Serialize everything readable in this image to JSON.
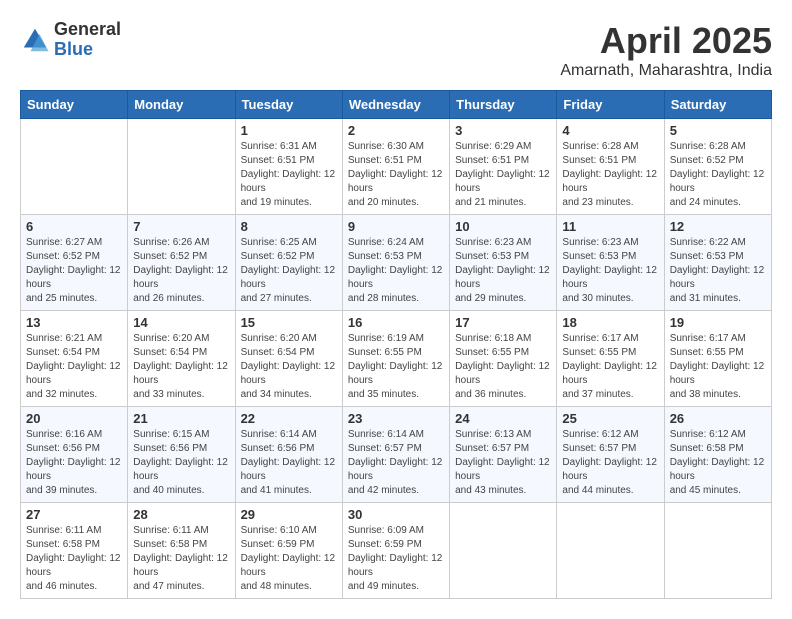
{
  "logo": {
    "general": "General",
    "blue": "Blue"
  },
  "title": "April 2025",
  "location": "Amarnath, Maharashtra, India",
  "days_of_week": [
    "Sunday",
    "Monday",
    "Tuesday",
    "Wednesday",
    "Thursday",
    "Friday",
    "Saturday"
  ],
  "weeks": [
    [
      {
        "day": "",
        "sunrise": "",
        "sunset": "",
        "daylight": ""
      },
      {
        "day": "",
        "sunrise": "",
        "sunset": "",
        "daylight": ""
      },
      {
        "day": "1",
        "sunrise": "Sunrise: 6:31 AM",
        "sunset": "Sunset: 6:51 PM",
        "daylight": "Daylight: 12 hours and 19 minutes."
      },
      {
        "day": "2",
        "sunrise": "Sunrise: 6:30 AM",
        "sunset": "Sunset: 6:51 PM",
        "daylight": "Daylight: 12 hours and 20 minutes."
      },
      {
        "day": "3",
        "sunrise": "Sunrise: 6:29 AM",
        "sunset": "Sunset: 6:51 PM",
        "daylight": "Daylight: 12 hours and 21 minutes."
      },
      {
        "day": "4",
        "sunrise": "Sunrise: 6:28 AM",
        "sunset": "Sunset: 6:51 PM",
        "daylight": "Daylight: 12 hours and 23 minutes."
      },
      {
        "day": "5",
        "sunrise": "Sunrise: 6:28 AM",
        "sunset": "Sunset: 6:52 PM",
        "daylight": "Daylight: 12 hours and 24 minutes."
      }
    ],
    [
      {
        "day": "6",
        "sunrise": "Sunrise: 6:27 AM",
        "sunset": "Sunset: 6:52 PM",
        "daylight": "Daylight: 12 hours and 25 minutes."
      },
      {
        "day": "7",
        "sunrise": "Sunrise: 6:26 AM",
        "sunset": "Sunset: 6:52 PM",
        "daylight": "Daylight: 12 hours and 26 minutes."
      },
      {
        "day": "8",
        "sunrise": "Sunrise: 6:25 AM",
        "sunset": "Sunset: 6:52 PM",
        "daylight": "Daylight: 12 hours and 27 minutes."
      },
      {
        "day": "9",
        "sunrise": "Sunrise: 6:24 AM",
        "sunset": "Sunset: 6:53 PM",
        "daylight": "Daylight: 12 hours and 28 minutes."
      },
      {
        "day": "10",
        "sunrise": "Sunrise: 6:23 AM",
        "sunset": "Sunset: 6:53 PM",
        "daylight": "Daylight: 12 hours and 29 minutes."
      },
      {
        "day": "11",
        "sunrise": "Sunrise: 6:23 AM",
        "sunset": "Sunset: 6:53 PM",
        "daylight": "Daylight: 12 hours and 30 minutes."
      },
      {
        "day": "12",
        "sunrise": "Sunrise: 6:22 AM",
        "sunset": "Sunset: 6:53 PM",
        "daylight": "Daylight: 12 hours and 31 minutes."
      }
    ],
    [
      {
        "day": "13",
        "sunrise": "Sunrise: 6:21 AM",
        "sunset": "Sunset: 6:54 PM",
        "daylight": "Daylight: 12 hours and 32 minutes."
      },
      {
        "day": "14",
        "sunrise": "Sunrise: 6:20 AM",
        "sunset": "Sunset: 6:54 PM",
        "daylight": "Daylight: 12 hours and 33 minutes."
      },
      {
        "day": "15",
        "sunrise": "Sunrise: 6:20 AM",
        "sunset": "Sunset: 6:54 PM",
        "daylight": "Daylight: 12 hours and 34 minutes."
      },
      {
        "day": "16",
        "sunrise": "Sunrise: 6:19 AM",
        "sunset": "Sunset: 6:55 PM",
        "daylight": "Daylight: 12 hours and 35 minutes."
      },
      {
        "day": "17",
        "sunrise": "Sunrise: 6:18 AM",
        "sunset": "Sunset: 6:55 PM",
        "daylight": "Daylight: 12 hours and 36 minutes."
      },
      {
        "day": "18",
        "sunrise": "Sunrise: 6:17 AM",
        "sunset": "Sunset: 6:55 PM",
        "daylight": "Daylight: 12 hours and 37 minutes."
      },
      {
        "day": "19",
        "sunrise": "Sunrise: 6:17 AM",
        "sunset": "Sunset: 6:55 PM",
        "daylight": "Daylight: 12 hours and 38 minutes."
      }
    ],
    [
      {
        "day": "20",
        "sunrise": "Sunrise: 6:16 AM",
        "sunset": "Sunset: 6:56 PM",
        "daylight": "Daylight: 12 hours and 39 minutes."
      },
      {
        "day": "21",
        "sunrise": "Sunrise: 6:15 AM",
        "sunset": "Sunset: 6:56 PM",
        "daylight": "Daylight: 12 hours and 40 minutes."
      },
      {
        "day": "22",
        "sunrise": "Sunrise: 6:14 AM",
        "sunset": "Sunset: 6:56 PM",
        "daylight": "Daylight: 12 hours and 41 minutes."
      },
      {
        "day": "23",
        "sunrise": "Sunrise: 6:14 AM",
        "sunset": "Sunset: 6:57 PM",
        "daylight": "Daylight: 12 hours and 42 minutes."
      },
      {
        "day": "24",
        "sunrise": "Sunrise: 6:13 AM",
        "sunset": "Sunset: 6:57 PM",
        "daylight": "Daylight: 12 hours and 43 minutes."
      },
      {
        "day": "25",
        "sunrise": "Sunrise: 6:12 AM",
        "sunset": "Sunset: 6:57 PM",
        "daylight": "Daylight: 12 hours and 44 minutes."
      },
      {
        "day": "26",
        "sunrise": "Sunrise: 6:12 AM",
        "sunset": "Sunset: 6:58 PM",
        "daylight": "Daylight: 12 hours and 45 minutes."
      }
    ],
    [
      {
        "day": "27",
        "sunrise": "Sunrise: 6:11 AM",
        "sunset": "Sunset: 6:58 PM",
        "daylight": "Daylight: 12 hours and 46 minutes."
      },
      {
        "day": "28",
        "sunrise": "Sunrise: 6:11 AM",
        "sunset": "Sunset: 6:58 PM",
        "daylight": "Daylight: 12 hours and 47 minutes."
      },
      {
        "day": "29",
        "sunrise": "Sunrise: 6:10 AM",
        "sunset": "Sunset: 6:59 PM",
        "daylight": "Daylight: 12 hours and 48 minutes."
      },
      {
        "day": "30",
        "sunrise": "Sunrise: 6:09 AM",
        "sunset": "Sunset: 6:59 PM",
        "daylight": "Daylight: 12 hours and 49 minutes."
      },
      {
        "day": "",
        "sunrise": "",
        "sunset": "",
        "daylight": ""
      },
      {
        "day": "",
        "sunrise": "",
        "sunset": "",
        "daylight": ""
      },
      {
        "day": "",
        "sunrise": "",
        "sunset": "",
        "daylight": ""
      }
    ]
  ]
}
